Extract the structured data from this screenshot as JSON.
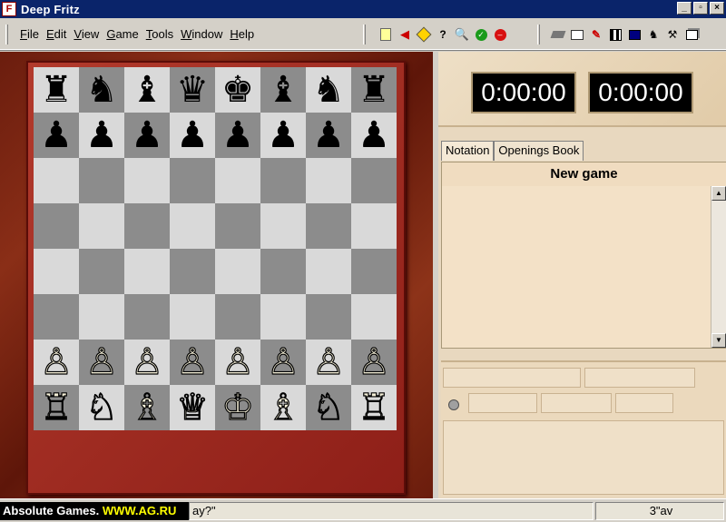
{
  "window": {
    "title": "Deep Fritz",
    "icon": "fritz-app-icon"
  },
  "menu": {
    "items": [
      "File",
      "Edit",
      "View",
      "Game",
      "Tools",
      "Window",
      "Help"
    ]
  },
  "toolbar": {
    "group1": [
      "new-game-icon",
      "take-back-icon",
      "hint-icon",
      "explain-icon",
      "analysis-icon",
      "accept-icon",
      "stop-icon"
    ],
    "group2": [
      "board-icon",
      "engine-icon",
      "edit-icon",
      "database-icon",
      "screen-icon",
      "piece-icon",
      "tools-icon",
      "windows-icon"
    ]
  },
  "board": {
    "rows": [
      [
        "♜",
        "♞",
        "♝",
        "♛",
        "♚",
        "♝",
        "♞",
        "♜"
      ],
      [
        "♟",
        "♟",
        "♟",
        "♟",
        "♟",
        "♟",
        "♟",
        "♟"
      ],
      [
        "",
        "",
        "",
        "",
        "",
        "",
        "",
        ""
      ],
      [
        "",
        "",
        "",
        "",
        "",
        "",
        "",
        ""
      ],
      [
        "",
        "",
        "",
        "",
        "",
        "",
        "",
        ""
      ],
      [
        "",
        "",
        "",
        "",
        "",
        "",
        "",
        ""
      ],
      [
        "♙",
        "♙",
        "♙",
        "♙",
        "♙",
        "♙",
        "♙",
        "♙"
      ],
      [
        "♖",
        "♘",
        "♗",
        "♕",
        "♔",
        "♗",
        "♘",
        "♖"
      ]
    ]
  },
  "clocks": {
    "left": "0:00:00",
    "right": "0:00:00"
  },
  "tabs": [
    {
      "label": "Notation",
      "active": true
    },
    {
      "label": "Openings Book",
      "active": false
    }
  ],
  "notation": {
    "heading": "New game"
  },
  "status": {
    "brand_prefix": "Absolute Games.",
    "brand_accent": "WWW.AG.RU",
    "message": "ay?\"",
    "right": "3\"av"
  }
}
